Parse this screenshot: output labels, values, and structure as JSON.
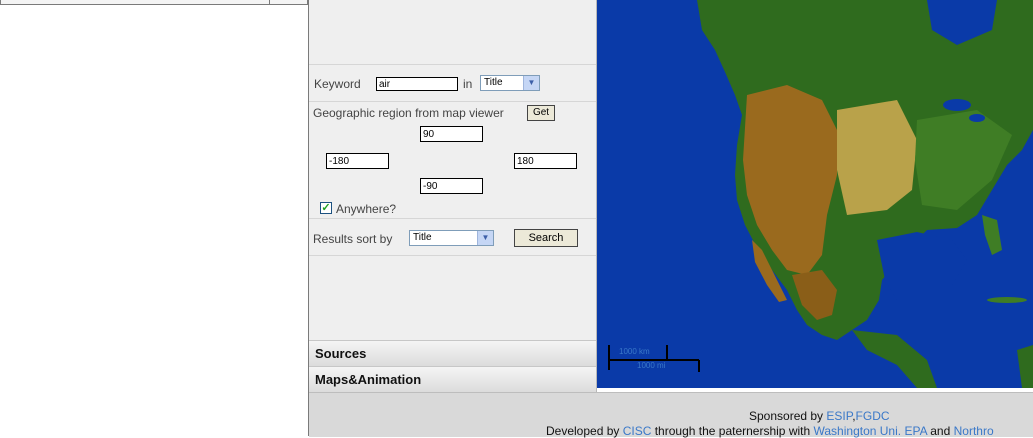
{
  "search": {
    "keyword_label": "Keyword",
    "keyword_value": "air",
    "in_label": "in",
    "field_selected": "Title",
    "geo_label": "Geographic region from map viewer",
    "get_button": "Get",
    "north": "90",
    "west": "-180",
    "east": "180",
    "south": "-90",
    "anywhere_label": "Anywhere?",
    "anywhere_checked": true,
    "sort_label": "Results sort by",
    "sort_selected": "Title",
    "search_button": "Search"
  },
  "accordion": {
    "sources": "Sources",
    "maps": "Maps&Animation"
  },
  "map": {
    "scale_km": "1000 km",
    "scale_mi": "1000 mi"
  },
  "footer": {
    "sponsored_prefix": "Sponsored by ",
    "sponsor1": "ESIP",
    "sponsor_sep": ",",
    "sponsor2": "FGDC",
    "developed_prefix": "Developed by ",
    "developer": "CISC",
    "developed_mid": " through the paternership with ",
    "partner1": "Washington Uni.",
    "partner_sep": " ",
    "partner2": "EPA",
    "and_text": " and ",
    "partner3": "Northro"
  },
  "colors": {
    "ocean": "#0a3aa8",
    "land_green": "#2f6b1e",
    "land_brown": "#9a6a1e",
    "link": "#3a78c8"
  }
}
